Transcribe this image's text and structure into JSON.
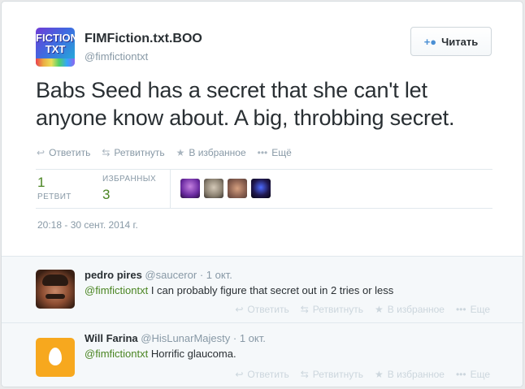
{
  "tweet": {
    "name": "FIMFiction.txt.BOO",
    "handle": "@fimfictiontxt",
    "avatar_text": "FICTION TXT",
    "follow_label": "Читать",
    "text": "Babs Seed has a secret that she can't let anyone know about. A big, throbbing secret.",
    "actions": {
      "reply": "Ответить",
      "retweet": "Ретвитнуть",
      "favorite": "В избранное",
      "more": "Ещё"
    },
    "stats": {
      "retweets_count": "1",
      "retweets_label": "РЕТВИТ",
      "favorites_label": "ИЗБРАННЫХ",
      "favorites_count": "3"
    },
    "favorited_by_icons": [
      "purple-pony-avatar",
      "gray-figure-avatar",
      "brown-figure-avatar",
      "dark-pony-avatar"
    ],
    "timestamp": "20:18 - 30 сент. 2014 г."
  },
  "replies": [
    {
      "name": "pedro pires",
      "handle": "@sauceror",
      "date": "· 1 окт.",
      "mention": "@fimfictiontxt",
      "text": " I can probably figure that secret out in 2 tries or less",
      "actions": {
        "reply": "Ответить",
        "retweet": "Ретвитнуть",
        "favorite": "В избранное",
        "more": "Еще"
      }
    },
    {
      "name": "Will Farina",
      "handle": "@HisLunarMajesty",
      "date": "· 1 окт.",
      "mention": "@fimfictiontxt",
      "text": " Horrific glaucoma.",
      "actions": {
        "reply": "Ответить",
        "retweet": "Ретвитнуть",
        "favorite": "В избранное",
        "more": "Еще"
      }
    }
  ],
  "colors": {
    "link_green": "#4a8522",
    "muted_gray": "#8899a6",
    "follow_icon_blue": "#4a8fd4",
    "egg_avatar_orange": "#f7a81e"
  }
}
